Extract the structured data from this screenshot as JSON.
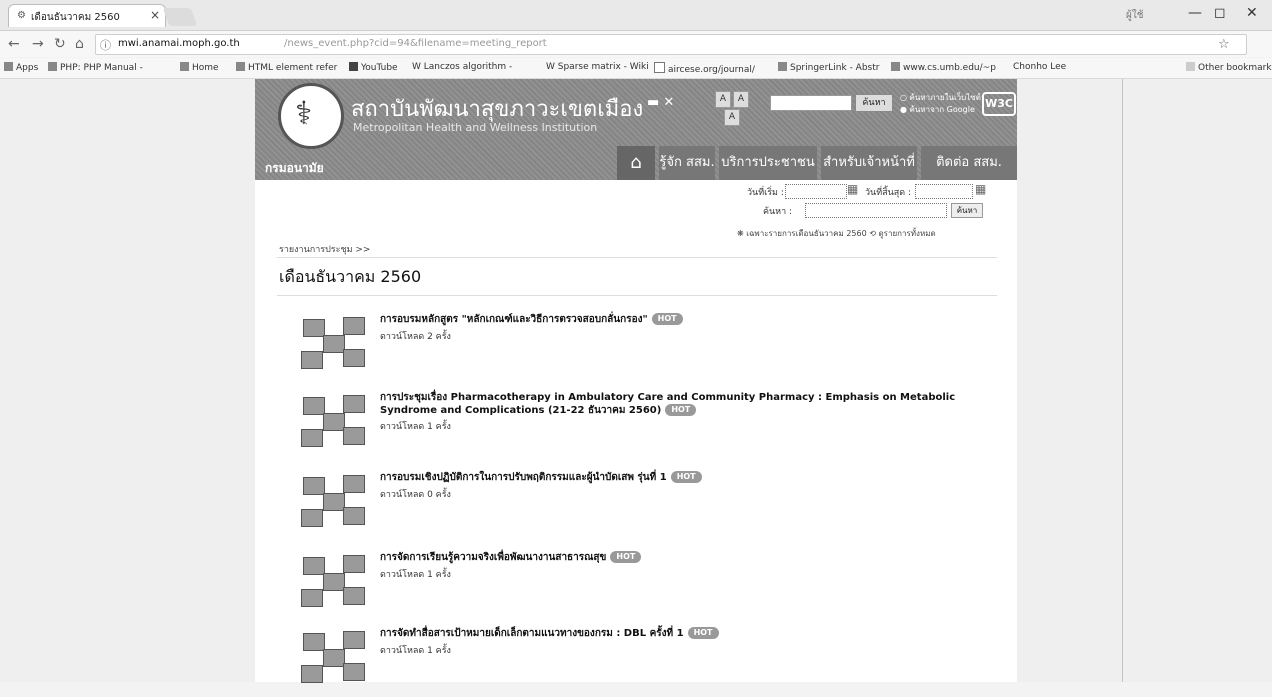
{
  "browser": {
    "tab_title": "เดือนธันวาคม 2560",
    "tab_close": "×",
    "window_user": "ผู้ใช้",
    "win_min": "—",
    "win_max": "◻",
    "win_close": "✕",
    "url_host": "mwi.anamai.moph.go.th",
    "url_path": "/news_event.php?cid=94&filename=meeting_report",
    "bookmarks": [
      "Apps",
      "PHP: PHP Manual -",
      "Home",
      "HTML element refer",
      "YouTube",
      "W Lanczos algorithm -",
      "W Sparse matrix - Wiki",
      "aircese.org/journal/",
      "SpringerLink - Abstr",
      "www.cs.umb.edu/~p",
      "Chonho Lee",
      "Other bookmarks"
    ]
  },
  "site": {
    "name_th": "สถาบันพัฒนาสุขภาวะเขตเมือง",
    "name_en": "Metropolitan Health and Wellness Institution",
    "dept": "กรมอนามัย",
    "font_buttons": [
      "A",
      "A",
      "A"
    ],
    "search_button": "ค้นหา",
    "search_option_site": "ค้นหาภายในเว็บไซต์",
    "search_option_google": "ค้นหาจาก Google",
    "w3c": "W3C",
    "nav": [
      "รู้จัก สสม.",
      "บริการประชาชน",
      "สำหรับเจ้าหน้าที่",
      "ติดต่อ สสม."
    ]
  },
  "filter": {
    "from_label": "วันที่เริ่ม :",
    "to_label": "วันที่สิ้นสุด :",
    "keyword_label": "ค้นหา :",
    "search_button": "ค้นหา",
    "link_month": "เฉพาะรายการเดือนธันวาคม 2560",
    "link_all": "ดูรายการทั้งหมด"
  },
  "breadcrumb": "รายงานการประชุม >>",
  "heading": "เดือนธันวาคม 2560",
  "hot_label": "HOT",
  "items": [
    {
      "title": "การอบรมหลักสูตร \"หลักเกณฑ์และวิธีการตรวจสอบกลั่นกรอง\"",
      "downloads": "ดาวน์โหลด 2 ครั้ง"
    },
    {
      "title": "การประชุมเรื่อง Pharmacotherapy in Ambulatory Care and Community Pharmacy : Emphasis on Metabolic Syndrome and Complications (21-22 ธันวาคม 2560)",
      "downloads": "ดาวน์โหลด 1 ครั้ง"
    },
    {
      "title": "การอบรมเชิงปฏิบัติการในการปรับพฤติกรรมและผู้นำบัดเสพ รุ่นที่ 1",
      "downloads": "ดาวน์โหลด 0 ครั้ง"
    },
    {
      "title": "การจัดการเรียนรู้ความจริงเพื่อพัฒนางานสาธารณสุข",
      "downloads": "ดาวน์โหลด 1 ครั้ง"
    },
    {
      "title": "การจัดทำสื่อสารเป้าหมายเด็กเล็กตามแนวทางของกรม : DBL ครั้งที่ 1",
      "downloads": "ดาวน์โหลด 1 ครั้ง"
    }
  ]
}
